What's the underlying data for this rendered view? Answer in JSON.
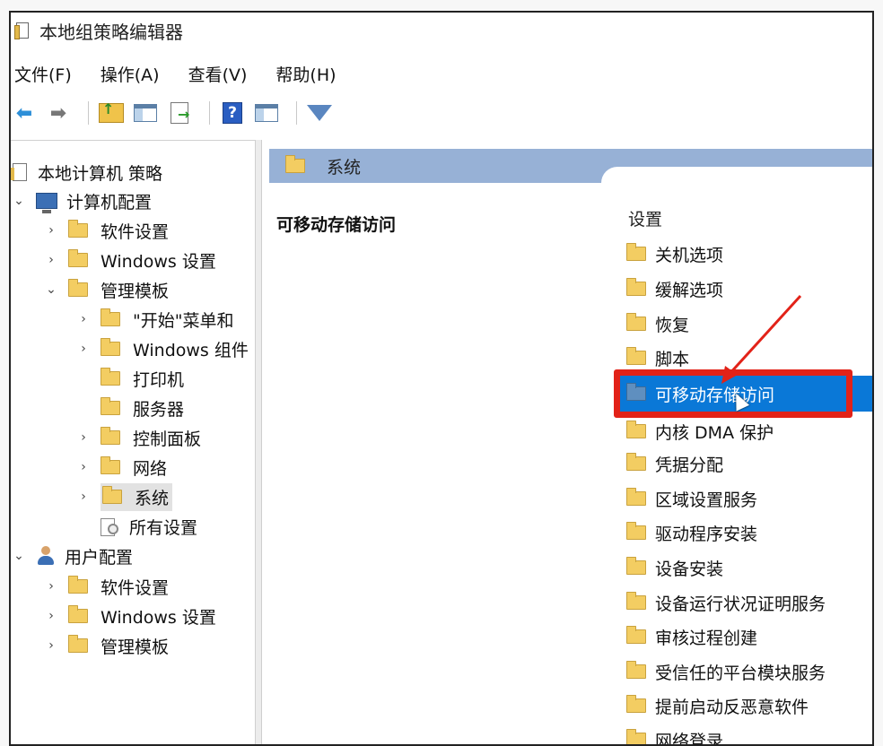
{
  "window": {
    "title": "本地组策略编辑器"
  },
  "menu": [
    {
      "label": "文件(F)"
    },
    {
      "label": "操作(A)"
    },
    {
      "label": "查看(V)"
    },
    {
      "label": "帮助(H)"
    }
  ],
  "toolbar": {
    "icons": [
      "back-arrow-icon",
      "forward-arrow-icon",
      "folder-up-icon",
      "show-hide-tree-icon",
      "export-list-icon",
      "help-icon",
      "console-pane-icon",
      "filter-icon"
    ]
  },
  "tree": {
    "root": "本地计算机 策略",
    "computer_config": "计算机配置",
    "cc_software": "软件设置",
    "cc_windows": "Windows 设置",
    "cc_admin": "管理模板",
    "start_menu": "\"开始\"菜单和",
    "windows_components": "Windows 组件",
    "printers": "打印机",
    "server": "服务器",
    "control_panel": "控制面板",
    "network": "网络",
    "system": "系统",
    "all_settings": "所有设置",
    "user_config": "用户配置",
    "uc_software": "软件设置",
    "uc_windows": "Windows 设置",
    "uc_admin": "管理模板"
  },
  "right": {
    "breadcrumb": "系统",
    "description_title": "可移动存储访问",
    "column_header": "设置",
    "items": [
      {
        "label": "关机选项"
      },
      {
        "label": "缓解选项"
      },
      {
        "label": "恢复"
      },
      {
        "label": "脚本"
      },
      {
        "label": "可移动存储访问"
      },
      {
        "label": "内核 DMA 保护"
      },
      {
        "label": "凭据分配"
      },
      {
        "label": "区域设置服务"
      },
      {
        "label": "驱动程序安装"
      },
      {
        "label": "设备安装"
      },
      {
        "label": "设备运行状况证明服务"
      },
      {
        "label": "审核过程创建"
      },
      {
        "label": "受信任的平台模块服务"
      },
      {
        "label": "提前启动反恶意软件"
      },
      {
        "label": "网络登录"
      }
    ],
    "selected_index": 4
  },
  "colors": {
    "selection": "#0a78d7",
    "highlight": "#e22218",
    "breadcrumb_bar": "#97b1d6",
    "folder": "#f3cd62"
  }
}
